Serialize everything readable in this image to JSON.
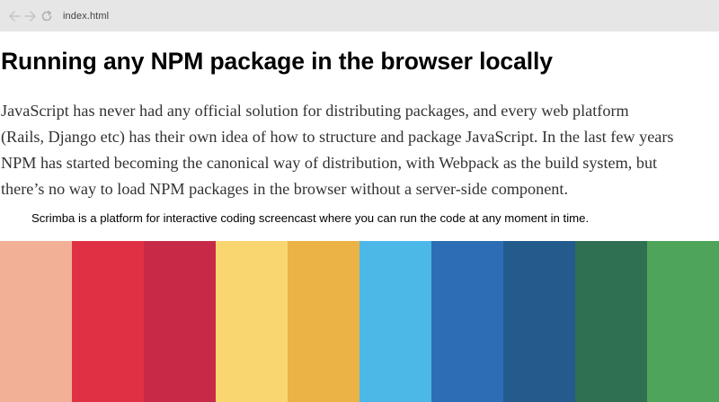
{
  "browser": {
    "url": "index.html",
    "back_icon": "arrow-left-icon",
    "forward_icon": "arrow-right-icon",
    "reload_icon": "reload-icon"
  },
  "article": {
    "title": "Running any NPM package in the browser locally",
    "paragraph_lines": [
      "JavaScript has never had any official solution for distributing packages, and every web platform",
      "(Rails, Django etc) has their own idea of how to structure and package JavaScript. In the last few years",
      "NPM has started becoming the canonical way of distribution, with Webpack as the build system, but",
      "there’s no way to load NPM packages in the browser without a server-side component."
    ],
    "caption": "Scrimba is a platform for interactive coding screencast where you can run the code at any moment in time."
  },
  "swatches": [
    {
      "color": "#f2b097"
    },
    {
      "color": "#e03044"
    },
    {
      "color": "#c72a46"
    },
    {
      "color": "#f9d670"
    },
    {
      "color": "#ebb245"
    },
    {
      "color": "#4bb8e7"
    },
    {
      "color": "#2d6db5"
    },
    {
      "color": "#225b8c"
    },
    {
      "color": "#2f7052"
    },
    {
      "color": "#4ea55a"
    }
  ]
}
